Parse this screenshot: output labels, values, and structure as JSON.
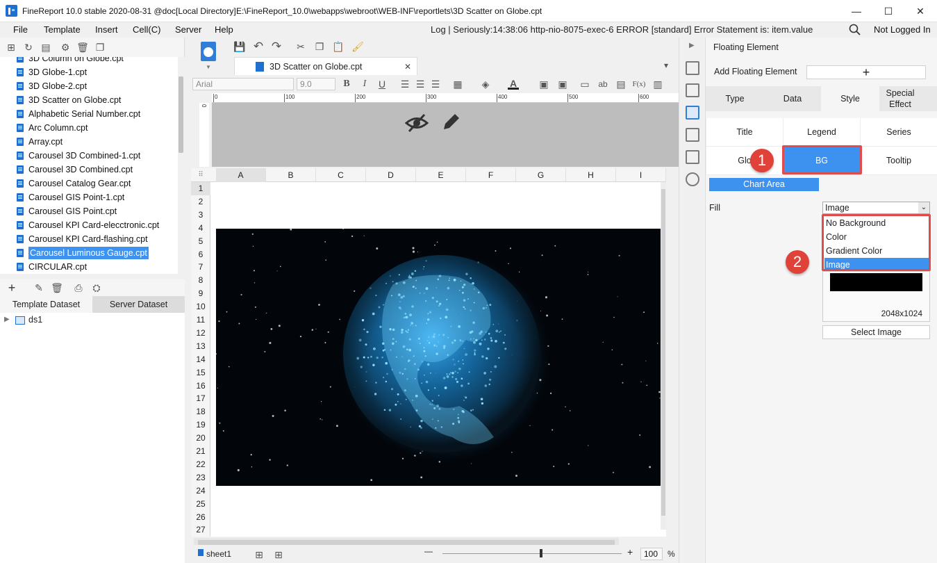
{
  "window": {
    "title": "FineReport 10.0 stable 2020-08-31 @doc[Local Directory]",
    "path": "E:\\FineReport_10.0\\webapps\\webroot\\WEB-INF\\reportlets\\3D Scatter on Globe.cpt",
    "minimize": "—",
    "maximize": "☐",
    "close": "✕"
  },
  "menu": {
    "items": [
      "File",
      "Template",
      "Insert",
      "Cell(C)",
      "Server",
      "Help"
    ],
    "log": "Log | Seriously:14:38:06 http-nio-8075-exec-6 ERROR [standard] Error Statement is: item.value",
    "login": "Not Logged In"
  },
  "files": {
    "items": [
      "3D Column on Globe.cpt",
      "3D Globe-1.cpt",
      "3D Globe-2.cpt",
      "3D Scatter on Globe.cpt",
      "Alphabetic Serial Number.cpt",
      "Arc Column.cpt",
      "Array.cpt",
      "Carousel 3D Combined-1.cpt",
      "Carousel 3D Combined.cpt",
      "Carousel Catalog Gear.cpt",
      "Carousel GIS Point-1.cpt",
      "Carousel GIS Point.cpt",
      "Carousel KPI Card-elecctronic.cpt",
      "Carousel KPI Card-flashing.cpt",
      "Carousel Luminous Gauge.cpt",
      "CIRCULAR.cpt"
    ],
    "selected": "Carousel Luminous Gauge.cpt"
  },
  "dataset": {
    "tabs": [
      "Template Dataset",
      "Server Dataset"
    ],
    "items": [
      "ds1"
    ]
  },
  "editor": {
    "tab": "3D Scatter on Globe.cpt",
    "font": "Arial",
    "font_size": "9.0",
    "ruler_ticks": [
      "0",
      "100",
      "200",
      "300",
      "400",
      "500",
      "600"
    ],
    "vruler_tick": "0",
    "columns": [
      "A",
      "B",
      "C",
      "D",
      "E",
      "F",
      "G",
      "H",
      "I"
    ],
    "rows": [
      "1",
      "2",
      "3",
      "4",
      "5",
      "6",
      "7",
      "8",
      "9",
      "10",
      "11",
      "12",
      "13",
      "14",
      "15",
      "16",
      "17",
      "18",
      "19",
      "20",
      "21",
      "22",
      "23",
      "24",
      "25",
      "26",
      "27"
    ],
    "sheet": "sheet1",
    "zoom": "100",
    "zoom_unit": "%",
    "zoom_minus": "—",
    "zoom_plus": "+"
  },
  "panel": {
    "title": "Floating Element",
    "add_label": "Add Floating Element",
    "add_glyph": "+",
    "tabs": [
      "Type",
      "Data",
      "Style",
      "Special Effect"
    ],
    "active_tab": "Style",
    "options": [
      "Title",
      "Legend",
      "Series",
      "Glo",
      "BG",
      "Tooltip"
    ],
    "active_option": "BG",
    "subtab": "Chart Area",
    "fill_label": "Fill",
    "fill_value": "Image",
    "fill_options": [
      "No Background",
      "Color",
      "Gradient Color",
      "Image"
    ],
    "image_size": "2048x1024",
    "select_image": "Select Image",
    "badges": [
      "1",
      "2"
    ]
  },
  "colors": {
    "accent": "#3d92ef",
    "highlight": "#e04c4c",
    "badge": "#e0423a"
  }
}
